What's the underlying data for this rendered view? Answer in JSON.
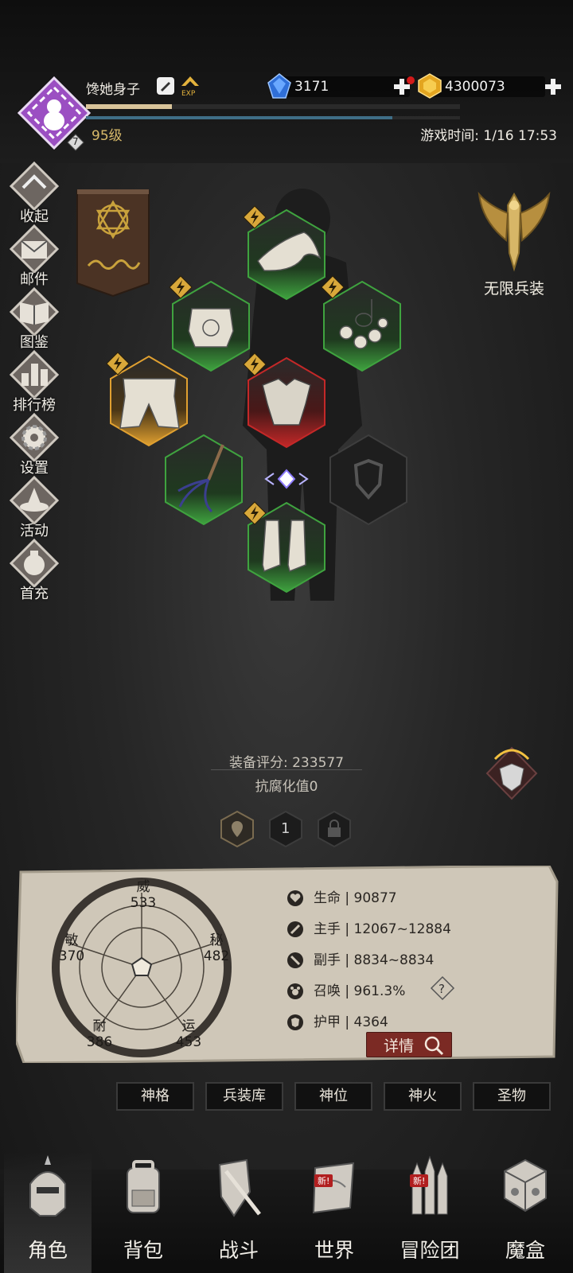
{
  "player": {
    "name": "馋她身子",
    "level_text": "95级",
    "avatar_badge": "7",
    "exp_progress": 0.23,
    "hp_progress": 0.82
  },
  "currency": {
    "gems": "3171",
    "gold": "4300073"
  },
  "game_time": "游戏时间: 1/16 17:53",
  "sidebar": [
    {
      "label": "收起",
      "icon": "collapse-icon"
    },
    {
      "label": "邮件",
      "icon": "mail-icon"
    },
    {
      "label": "图鉴",
      "icon": "book-icon"
    },
    {
      "label": "排行榜",
      "icon": "ranking-icon"
    },
    {
      "label": "设置",
      "icon": "settings-icon"
    },
    {
      "label": "活动",
      "icon": "activity-icon"
    },
    {
      "label": "首充",
      "icon": "first-recharge-icon"
    }
  ],
  "infinite_armament": {
    "label": "无限兵装"
  },
  "equipment": [
    {
      "slot": "hat",
      "rarity": "green"
    },
    {
      "slot": "chest",
      "rarity": "green"
    },
    {
      "slot": "necklace",
      "rarity": "green"
    },
    {
      "slot": "belt",
      "rarity": "orange"
    },
    {
      "slot": "armor",
      "rarity": "red"
    },
    {
      "slot": "weapon",
      "rarity": "green"
    },
    {
      "slot": "offhand",
      "rarity": "empty"
    },
    {
      "slot": "boots",
      "rarity": "green"
    }
  ],
  "stats": {
    "score_text": "装备评分: 233577",
    "corruption_text": "抗腐化值0",
    "page_number": "1"
  },
  "attributes": {
    "wei": {
      "label": "威",
      "value": "533"
    },
    "mi": {
      "label": "秘",
      "value": "482"
    },
    "yun": {
      "label": "运",
      "value": "453"
    },
    "nai": {
      "label": "耐",
      "value": "386"
    },
    "min": {
      "label": "敏",
      "value": "370"
    }
  },
  "stat_lines": {
    "life": "生命 | 90877",
    "main_hand": "主手 | 12067~12884",
    "off_hand": "副手 | 8834~8834",
    "summon": "召唤 | 961.3%",
    "armor": "护甲 | 4364"
  },
  "detail_button": "详情",
  "tab_buttons": [
    "神格",
    "兵装库",
    "神位",
    "神火",
    "圣物"
  ],
  "bottom_nav": [
    {
      "label": "角色",
      "active": true
    },
    {
      "label": "背包",
      "active": false
    },
    {
      "label": "战斗",
      "active": false
    },
    {
      "label": "世界",
      "active": false,
      "tag": "新!"
    },
    {
      "label": "冒险团",
      "active": false,
      "tag": "新!"
    },
    {
      "label": "魔盒",
      "active": false
    }
  ],
  "colors": {
    "rarity_green": "#3fa33f",
    "rarity_orange": "#e0a030",
    "rarity_red": "#c42828",
    "avatar_purple": "#9b4fc2",
    "level_gold": "#d7b96a"
  }
}
